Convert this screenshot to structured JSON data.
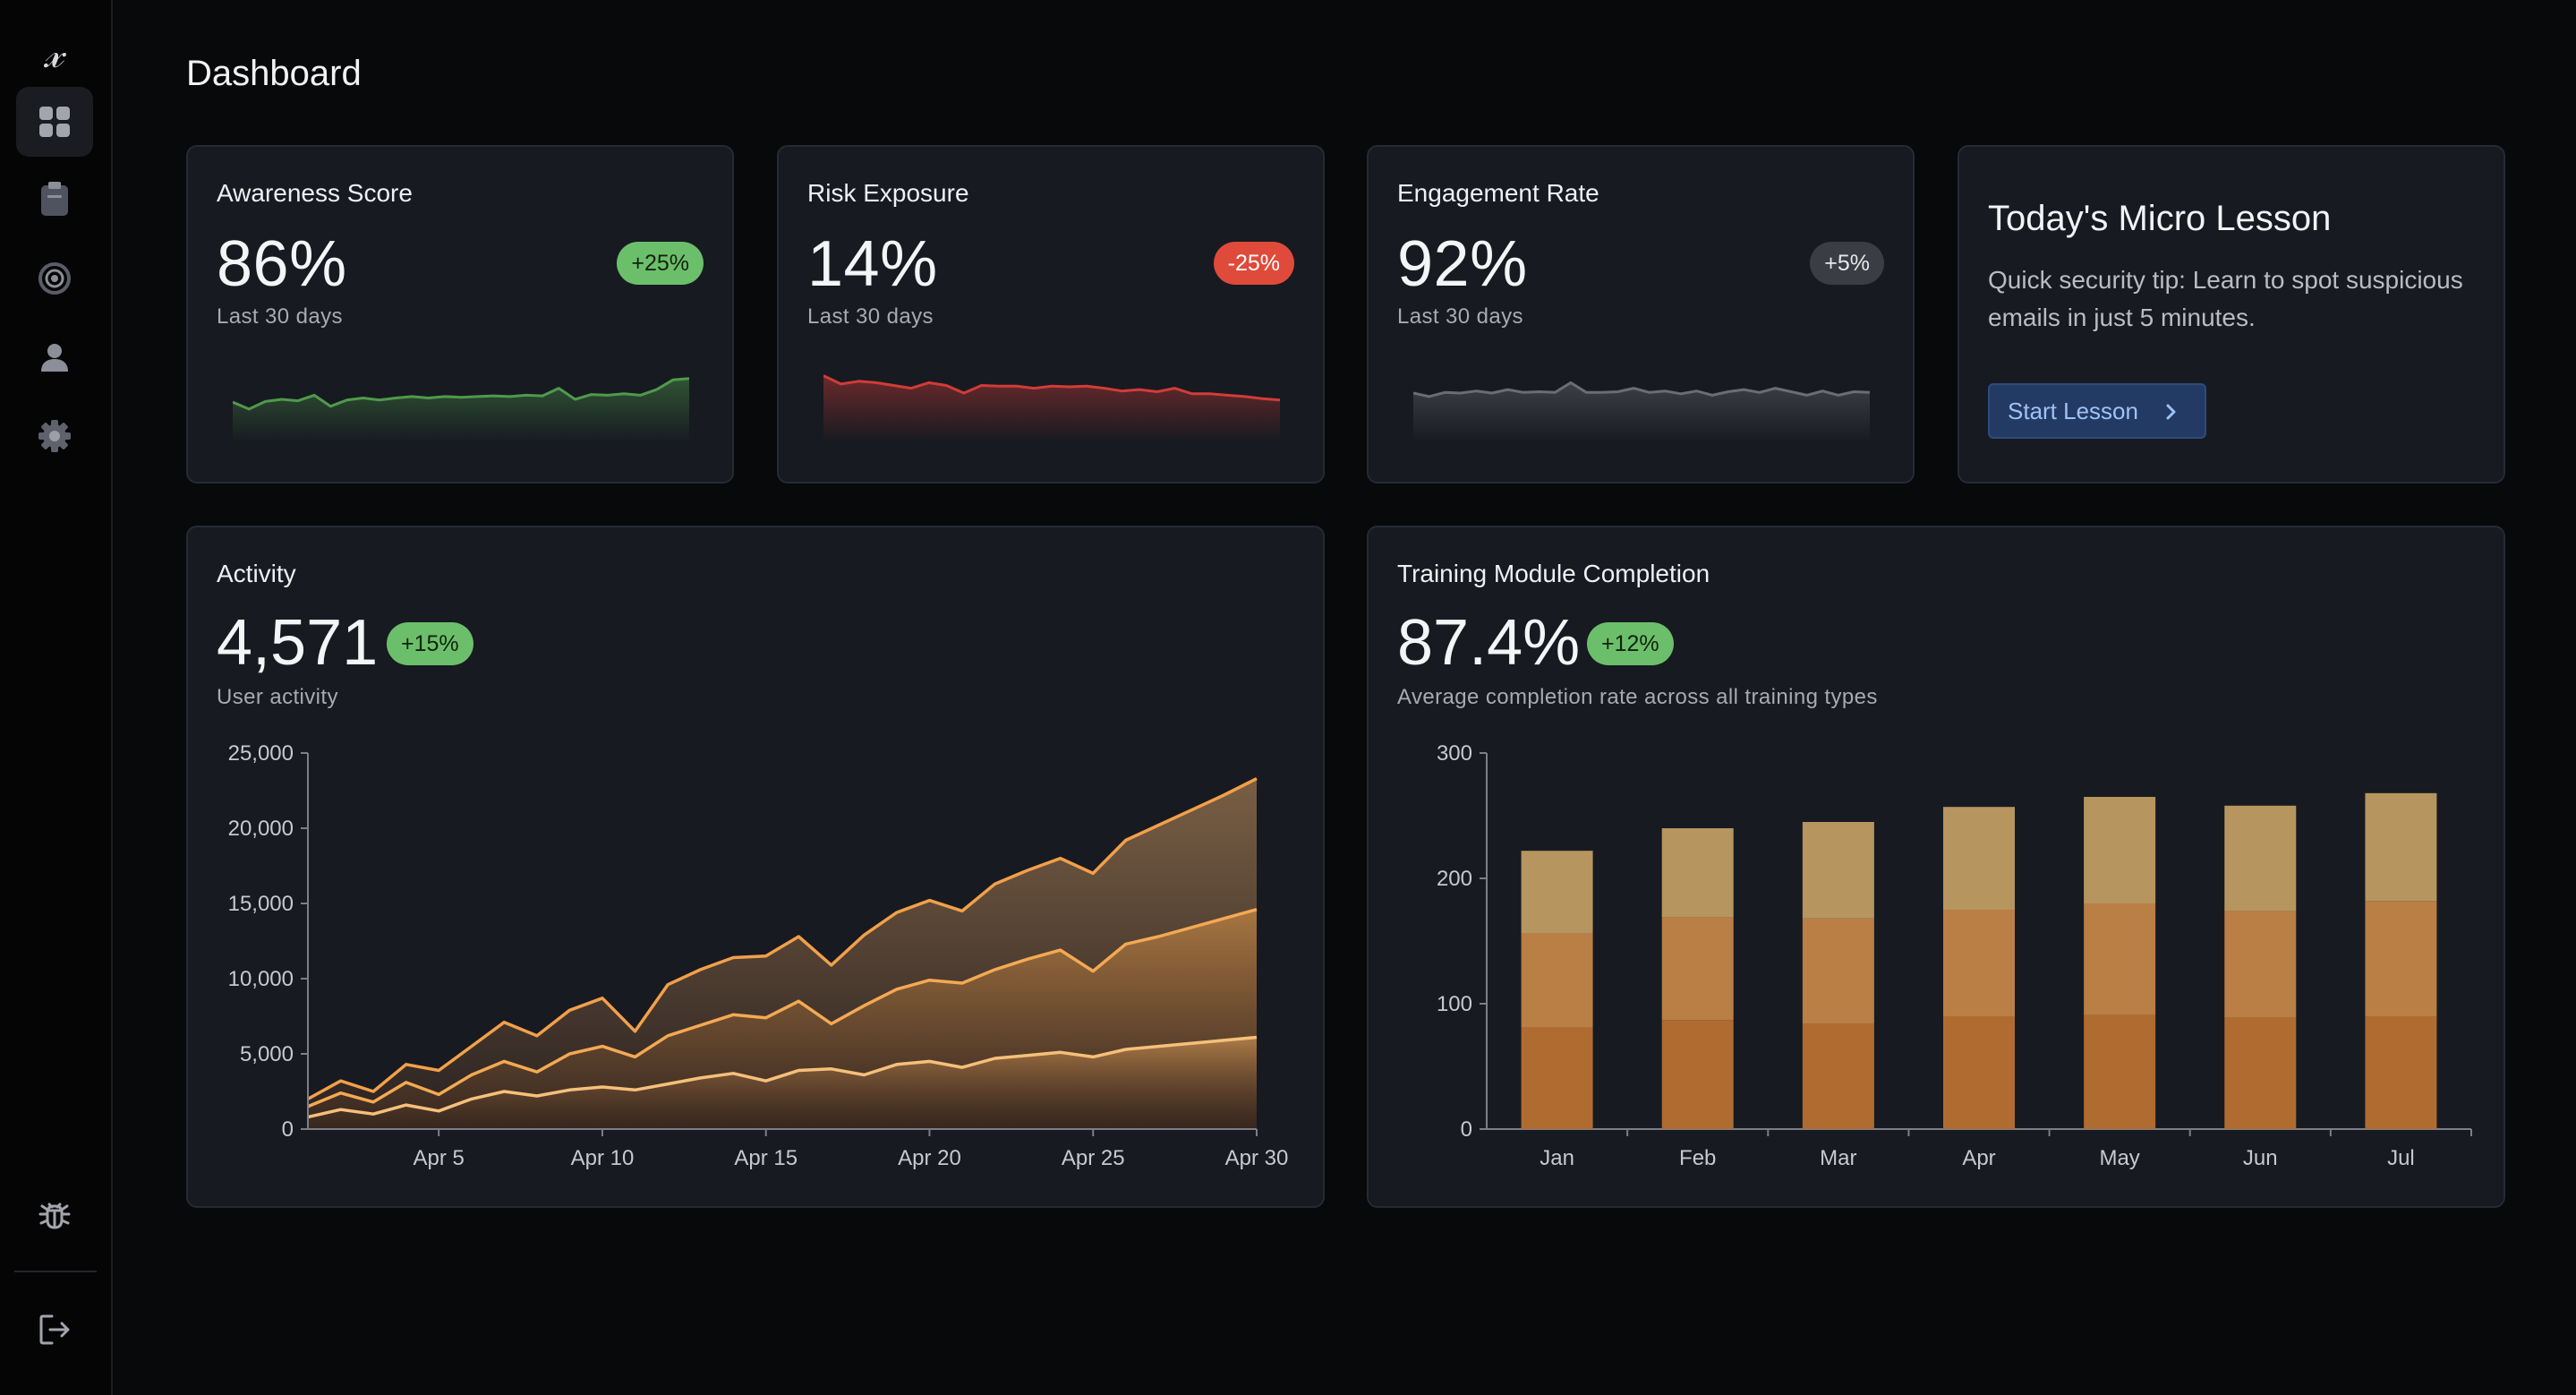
{
  "app": {
    "logo": "𝓍",
    "page_title": "Dashboard"
  },
  "sidebar": {
    "items": [
      {
        "icon": "dashboard-grid-icon",
        "active": true
      },
      {
        "icon": "clipboard-icon",
        "active": false
      },
      {
        "icon": "target-icon",
        "active": false
      },
      {
        "icon": "user-icon",
        "active": false
      },
      {
        "icon": "gear-icon",
        "active": false
      }
    ],
    "bottom": [
      {
        "icon": "bug-icon"
      },
      {
        "icon": "logout-icon"
      }
    ]
  },
  "kpis": [
    {
      "title": "Awareness Score",
      "value": "86%",
      "badge": "+25%",
      "badge_tone": "green",
      "subtitle": "Last 30 days",
      "line_color": "#4f9a4b",
      "trend": [
        32,
        22,
        33,
        36,
        34,
        42,
        26,
        35,
        38,
        35,
        38,
        40,
        38,
        40,
        39,
        40,
        41,
        40,
        42,
        41,
        52,
        36,
        43,
        42,
        44,
        42,
        50,
        64,
        66
      ]
    },
    {
      "title": "Risk Exposure",
      "value": "14%",
      "badge": "-25%",
      "badge_tone": "red",
      "subtitle": "Last 30 days",
      "line_color": "#d13c37",
      "trend": [
        70,
        58,
        62,
        60,
        56,
        52,
        60,
        56,
        45,
        56,
        55,
        55,
        52,
        55,
        54,
        55,
        52,
        48,
        50,
        47,
        52,
        44,
        44,
        42,
        40,
        37,
        35
      ]
    },
    {
      "title": "Engagement Rate",
      "value": "92%",
      "badge": "+5%",
      "badge_tone": "gray",
      "subtitle": "Last 30 days",
      "line_color": "#6b6d73",
      "trend": [
        45,
        40,
        46,
        45,
        48,
        45,
        50,
        46,
        47,
        46,
        60,
        46,
        46,
        47,
        52,
        46,
        48,
        44,
        48,
        42,
        47,
        50,
        46,
        52,
        47,
        42,
        48,
        42,
        47,
        46
      ]
    }
  ],
  "lesson": {
    "title": "Today's Micro Lesson",
    "text": "Quick security tip: Learn to spot suspicious emails in just 5 minutes.",
    "button": "Start Lesson"
  },
  "activity": {
    "title": "Activity",
    "value": "4,571",
    "badge": "+15%",
    "subtitle": "User activity"
  },
  "training": {
    "title": "Training Module Completion",
    "value": "87.4%",
    "badge": "+12%",
    "subtitle": "Average completion rate across all training types"
  },
  "chart_data": [
    {
      "type": "area",
      "title": "Activity",
      "xlabel": "",
      "ylabel": "",
      "x": [
        1,
        2,
        3,
        4,
        5,
        6,
        7,
        8,
        9,
        10,
        11,
        12,
        13,
        14,
        15,
        16,
        17,
        18,
        19,
        20,
        21,
        22,
        23,
        24,
        25,
        26,
        27,
        28,
        29,
        30
      ],
      "x_ticks": [
        "Apr 5",
        "Apr 10",
        "Apr 15",
        "Apr 20",
        "Apr 25",
        "Apr 30"
      ],
      "x_tick_values": [
        5,
        10,
        15,
        20,
        25,
        30
      ],
      "ylim": [
        0,
        25000
      ],
      "y_ticks": [
        "0",
        "5,000",
        "10,000",
        "15,000",
        "20,000",
        "25,000"
      ],
      "y_tick_values": [
        0,
        5000,
        10000,
        15000,
        20000,
        25000
      ],
      "series": [
        {
          "color": "#f2a04a",
          "values": [
            2000,
            3200,
            2500,
            4300,
            3900,
            5500,
            7100,
            6200,
            7900,
            8700,
            6500,
            9600,
            10600,
            11400,
            11500,
            12800,
            10900,
            12900,
            14400,
            15200,
            14500,
            16300,
            17200,
            18000,
            17000,
            19200,
            20200,
            21200,
            22200,
            23300
          ]
        },
        {
          "color": "#f4a952",
          "values": [
            1500,
            2400,
            1800,
            3100,
            2300,
            3600,
            4500,
            3800,
            5000,
            5500,
            4800,
            6200,
            6900,
            7600,
            7400,
            8500,
            7000,
            8200,
            9300,
            9900,
            9700,
            10600,
            11300,
            11900,
            10500,
            12300,
            12800,
            13400,
            14000,
            14600
          ]
        },
        {
          "color": "#f6c07a",
          "values": [
            800,
            1300,
            1000,
            1600,
            1200,
            2000,
            2500,
            2200,
            2600,
            2800,
            2600,
            3000,
            3400,
            3700,
            3200,
            3900,
            4000,
            3600,
            4300,
            4500,
            4100,
            4700,
            4900,
            5100,
            4800,
            5300,
            5500,
            5700,
            5900,
            6100
          ]
        }
      ]
    },
    {
      "type": "bar",
      "stacked": true,
      "title": "Training Module Completion",
      "categories": [
        "Jan",
        "Feb",
        "Mar",
        "Apr",
        "May",
        "Jun",
        "Jul"
      ],
      "ylim": [
        0,
        300
      ],
      "y_ticks": [
        "0",
        "100",
        "200",
        "300"
      ],
      "y_tick_values": [
        0,
        100,
        200,
        300
      ],
      "series": [
        {
          "color": "#b06c30",
          "values": [
            81,
            87,
            84,
            90,
            91,
            89,
            90
          ]
        },
        {
          "color": "#b97f45",
          "values": [
            75,
            82,
            84,
            85,
            89,
            85,
            92
          ]
        },
        {
          "color": "#b7955f",
          "values": [
            66,
            71,
            77,
            82,
            85,
            84,
            86
          ]
        }
      ]
    }
  ]
}
